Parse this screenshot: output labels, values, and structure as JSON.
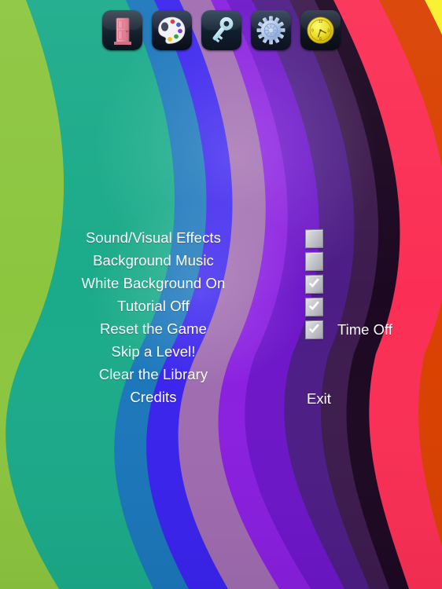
{
  "app": {
    "title": "Game Options Screen",
    "background_palette": {
      "green": "#8cc63f",
      "teal": "#1bab8a",
      "blue": "#1b77bb",
      "royal_blue": "#3a23ee",
      "mauve": "#a06cb0",
      "violet": "#8a1fe0",
      "purple": "#6d16c9",
      "deep_purple": "#4d1d86",
      "plum": "#3d1b4e",
      "near_black": "#1d0822",
      "pink_red": "#fb2f55",
      "orange": "#d94100",
      "yellow": "#f8f02a"
    }
  },
  "toolbar": {
    "items": [
      {
        "name": "door-icon",
        "label": "Door",
        "title": "Exit / Rooms"
      },
      {
        "name": "palette-icon",
        "label": "Palette",
        "title": "Colors"
      },
      {
        "name": "key-icon",
        "label": "Key",
        "title": "Unlock"
      },
      {
        "name": "gear-icon",
        "label": "Gear",
        "title": "Settings"
      },
      {
        "name": "clock-icon",
        "label": "Clock",
        "title": "Time"
      }
    ]
  },
  "menu": {
    "items": [
      {
        "label": "Sound/Visual Effects",
        "has_checkbox": true,
        "checked": false
      },
      {
        "label": "Background Music",
        "has_checkbox": true,
        "checked": false
      },
      {
        "label": "White Background On",
        "has_checkbox": true,
        "checked": true
      },
      {
        "label": "Tutorial Off",
        "has_checkbox": true,
        "checked": true
      },
      {
        "label": "Reset the Game",
        "has_checkbox": true,
        "checked": true
      },
      {
        "label": "Skip a Level!",
        "has_checkbox": false,
        "checked": false
      },
      {
        "label": "Clear the Library",
        "has_checkbox": false,
        "checked": false
      },
      {
        "label": "Credits",
        "has_checkbox": false,
        "checked": false
      }
    ]
  },
  "right_labels": {
    "time_off": "Time Off",
    "exit": "Exit"
  },
  "colors": {
    "text": "#ffffff",
    "checkbox_face": "#c8c8cf",
    "checkbox_check": "#ffffff"
  }
}
